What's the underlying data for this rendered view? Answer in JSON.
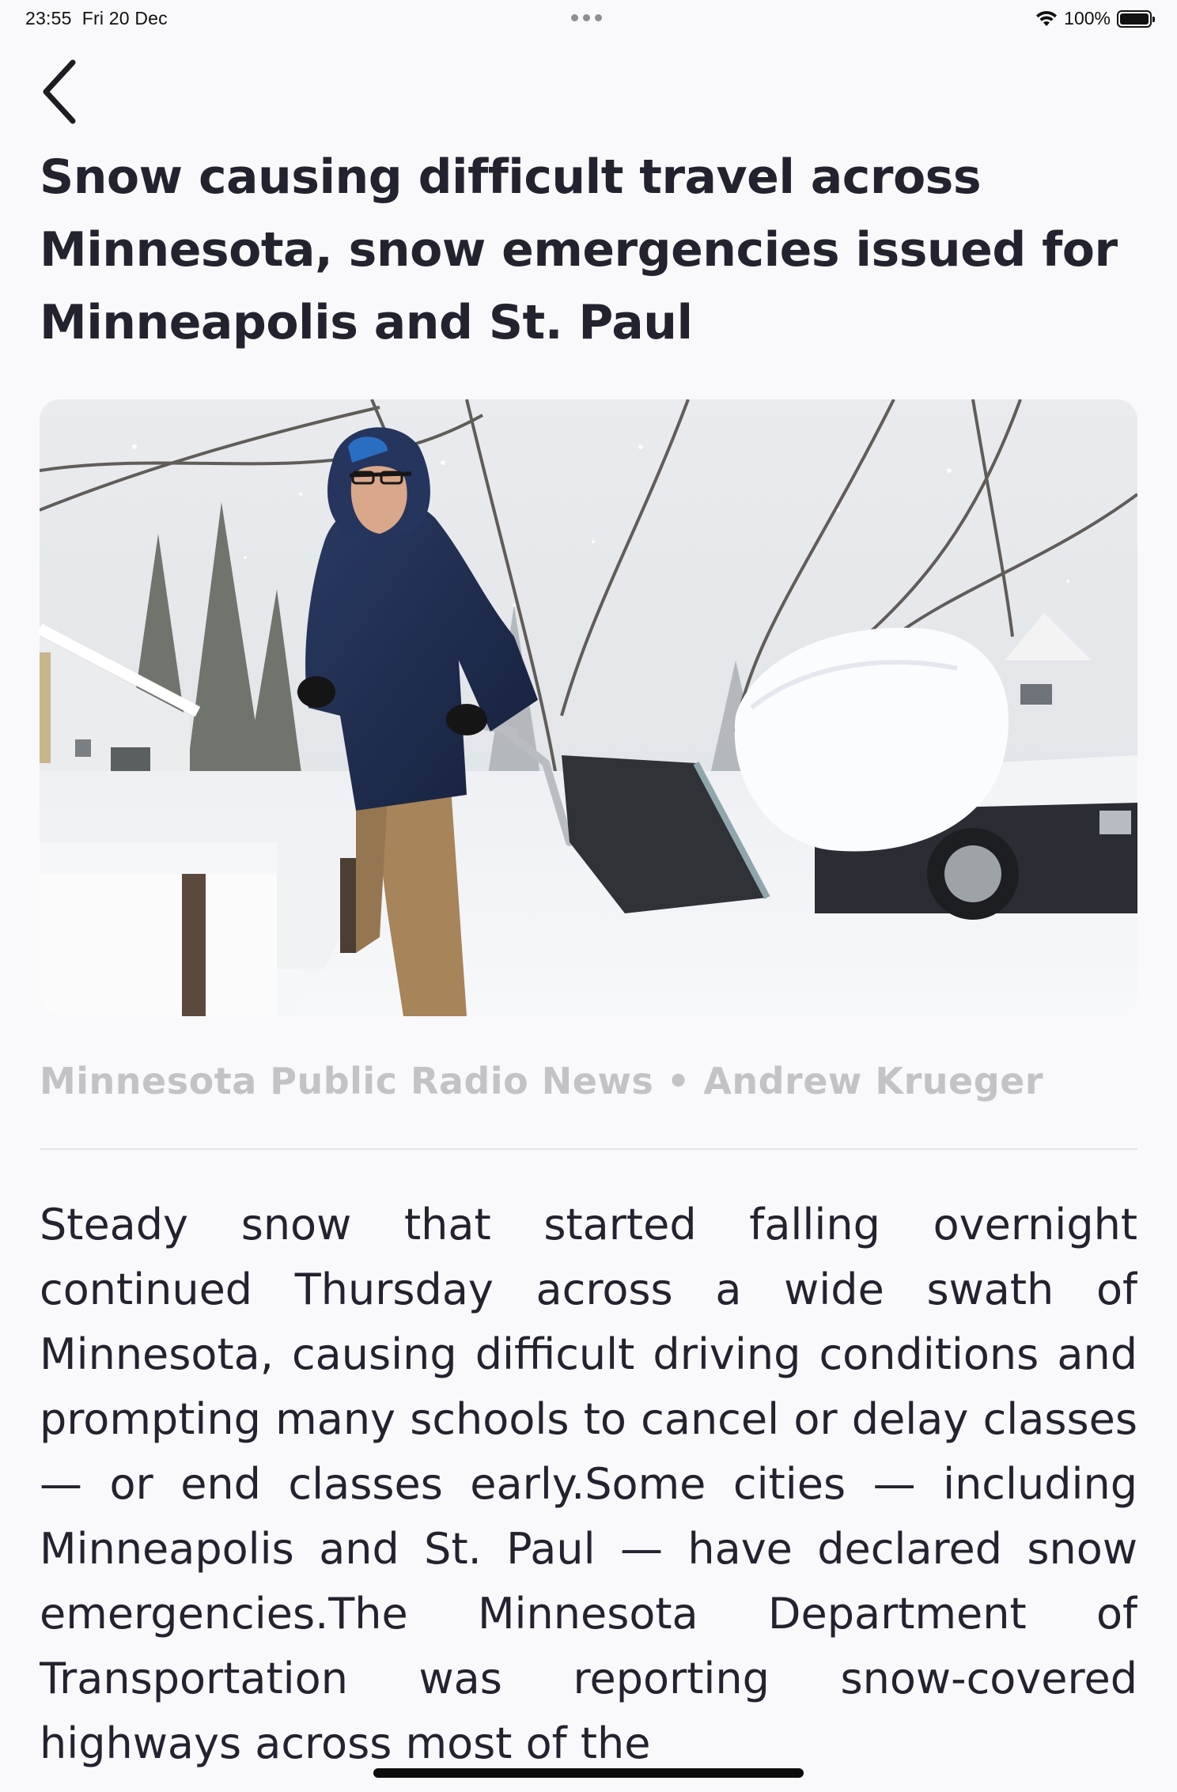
{
  "status_bar": {
    "time": "23:55",
    "date": "Fri 20 Dec",
    "battery_percent": "100%",
    "battery_level": 1.0,
    "icons": [
      "wifi-icon",
      "battery-icon",
      "multitasking-dots-icon"
    ]
  },
  "navigation": {
    "back_icon": "chevron-left-icon"
  },
  "article": {
    "title": "Snow causing difficult travel across Minnesota, snow emergencies issued for Minneapolis and St. Paul",
    "byline": "Minnesota Public Radio News • Andrew Krueger",
    "body": "Steady snow that started falling overnight continued Thursday across a wide swath of Minnesota, causing difficult driving conditions and prompting many schools to cancel or delay classes — or end classes early.Some cities — including Minneapolis and St. Paul — have declared snow emergencies.The Minnesota Department of Transportation was reporting snow-covered highways across most of the"
  },
  "colors": {
    "background": "#f9f9fb",
    "title": "#232330",
    "byline": "#c3c3c6",
    "divider": "#e6e6ea"
  }
}
